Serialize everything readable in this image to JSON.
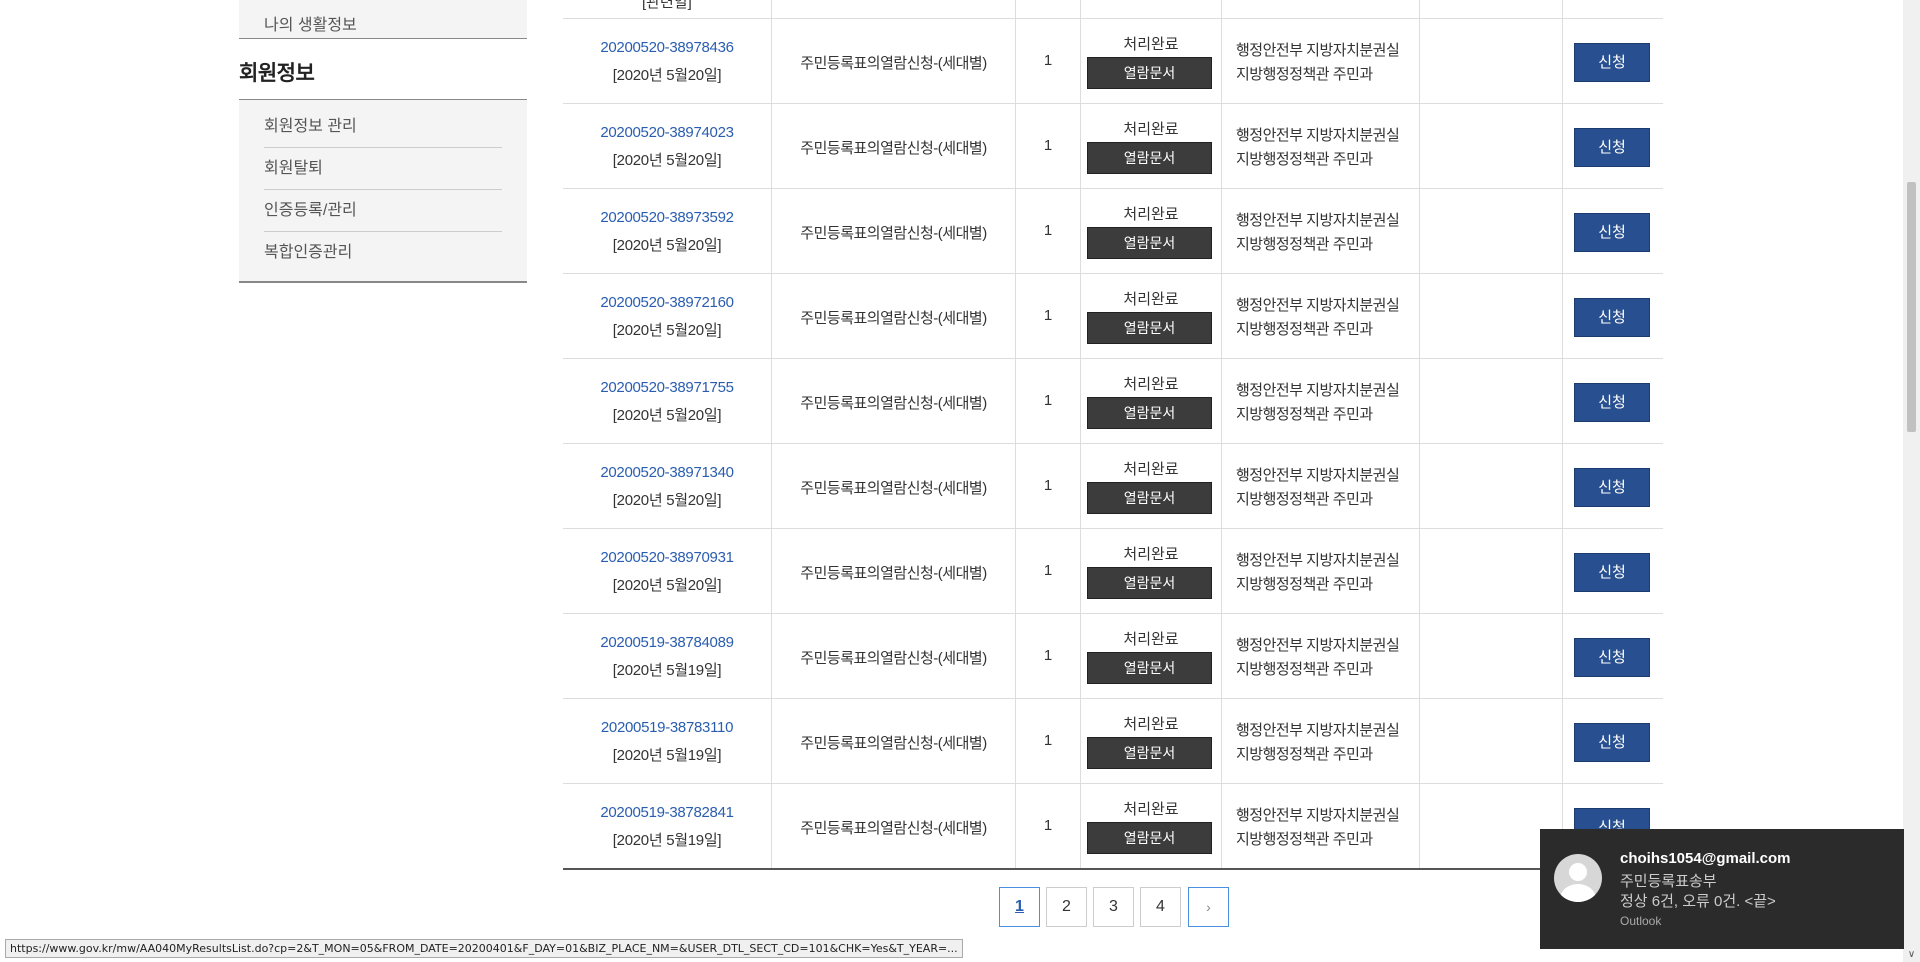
{
  "sidebar": {
    "top_item": "나의 생활정보",
    "section_title": "회원정보",
    "items": [
      "회원정보 관리",
      "회원탈퇴",
      "인증등록/관리",
      "복합인증관리"
    ]
  },
  "table": {
    "top_partial_date": "[관련일]",
    "rows": [
      {
        "id": "20200520-38978436",
        "date": "[2020년 5월20일]",
        "service": "주민등록표의열람신청-(세대별)",
        "qty": "1",
        "status": "처리완료",
        "doc_btn": "열람문서",
        "org_line1": "행정안전부 지방자치분권실",
        "org_line2": "지방행정정책관 주민과",
        "apply": "신청"
      },
      {
        "id": "20200520-38974023",
        "date": "[2020년 5월20일]",
        "service": "주민등록표의열람신청-(세대별)",
        "qty": "1",
        "status": "처리완료",
        "doc_btn": "열람문서",
        "org_line1": "행정안전부 지방자치분권실",
        "org_line2": "지방행정정책관 주민과",
        "apply": "신청"
      },
      {
        "id": "20200520-38973592",
        "date": "[2020년 5월20일]",
        "service": "주민등록표의열람신청-(세대별)",
        "qty": "1",
        "status": "처리완료",
        "doc_btn": "열람문서",
        "org_line1": "행정안전부 지방자치분권실",
        "org_line2": "지방행정정책관 주민과",
        "apply": "신청"
      },
      {
        "id": "20200520-38972160",
        "date": "[2020년 5월20일]",
        "service": "주민등록표의열람신청-(세대별)",
        "qty": "1",
        "status": "처리완료",
        "doc_btn": "열람문서",
        "org_line1": "행정안전부 지방자치분권실",
        "org_line2": "지방행정정책관 주민과",
        "apply": "신청"
      },
      {
        "id": "20200520-38971755",
        "date": "[2020년 5월20일]",
        "service": "주민등록표의열람신청-(세대별)",
        "qty": "1",
        "status": "처리완료",
        "doc_btn": "열람문서",
        "org_line1": "행정안전부 지방자치분권실",
        "org_line2": "지방행정정책관 주민과",
        "apply": "신청"
      },
      {
        "id": "20200520-38971340",
        "date": "[2020년 5월20일]",
        "service": "주민등록표의열람신청-(세대별)",
        "qty": "1",
        "status": "처리완료",
        "doc_btn": "열람문서",
        "org_line1": "행정안전부 지방자치분권실",
        "org_line2": "지방행정정책관 주민과",
        "apply": "신청"
      },
      {
        "id": "20200520-38970931",
        "date": "[2020년 5월20일]",
        "service": "주민등록표의열람신청-(세대별)",
        "qty": "1",
        "status": "처리완료",
        "doc_btn": "열람문서",
        "org_line1": "행정안전부 지방자치분권실",
        "org_line2": "지방행정정책관 주민과",
        "apply": "신청"
      },
      {
        "id": "20200519-38784089",
        "date": "[2020년 5월19일]",
        "service": "주민등록표의열람신청-(세대별)",
        "qty": "1",
        "status": "처리완료",
        "doc_btn": "열람문서",
        "org_line1": "행정안전부 지방자치분권실",
        "org_line2": "지방행정정책관 주민과",
        "apply": "신청"
      },
      {
        "id": "20200519-38783110",
        "date": "[2020년 5월19일]",
        "service": "주민등록표의열람신청-(세대별)",
        "qty": "1",
        "status": "처리완료",
        "doc_btn": "열람문서",
        "org_line1": "행정안전부 지방자치분권실",
        "org_line2": "지방행정정책관 주민과",
        "apply": "신청"
      },
      {
        "id": "20200519-38782841",
        "date": "[2020년 5월19일]",
        "service": "주민등록표의열람신청-(세대별)",
        "qty": "1",
        "status": "처리완료",
        "doc_btn": "열람문서",
        "org_line1": "행정안전부 지방자치분권실",
        "org_line2": "지방행정정책관 주민과",
        "apply": "신청"
      }
    ]
  },
  "pagination": {
    "pages": [
      "1",
      "2",
      "3",
      "4"
    ],
    "current": "1",
    "next_icon": "chevron-right-icon"
  },
  "status_bar": {
    "url": "https://www.gov.kr/mw/AA040MyResultsList.do?cp=2&T_MON=05&FROM_DATE=20200401&F_DAY=01&BIZ_PLACE_NM=&USER_DTL_SECT_CD=101&CHK=Yes&T_YEAR=..."
  },
  "notification": {
    "sender": "choihs1054@gmail.com",
    "subject": "주민등록표송부",
    "body": "정상 6건, 오류 0건. <끝>",
    "app": "Outlook",
    "avatar_icon": "person-icon"
  },
  "colors": {
    "link": "#2a5db0",
    "apply_button": "#284f8f",
    "doc_button": "#3c3c3c",
    "toast_bg": "#2b2b2b"
  }
}
